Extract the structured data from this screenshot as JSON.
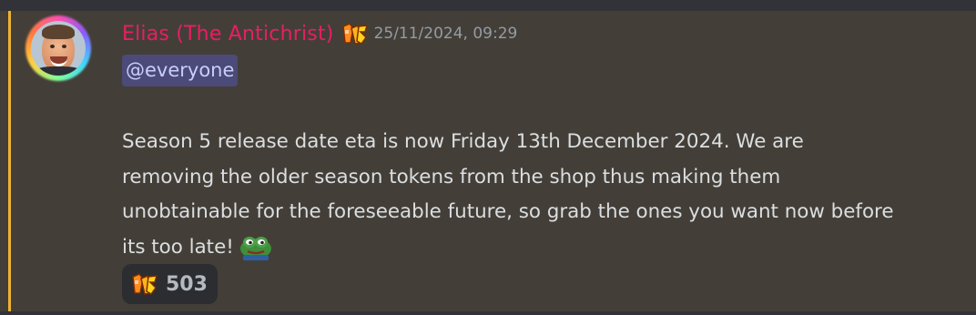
{
  "message": {
    "author": "Elias (The Antichrist)",
    "author_color": "#e91e63",
    "role_icon": "pas-badge-icon",
    "timestamp": "25/11/2024, 09:29",
    "mention": "@everyone",
    "body": "Season 5 release date eta is now Friday 13th December 2024. We are removing the older season tokens from the shop thus making them unobtainable for the foreseeable future, so grab the ones you want now before its too late!",
    "emoji": "pepe-emoji-icon",
    "mention_bar_color": "#f0b232",
    "background": "#433f38"
  },
  "reactions": [
    {
      "emoji": "pas-emoji-icon",
      "count": "503"
    }
  ]
}
